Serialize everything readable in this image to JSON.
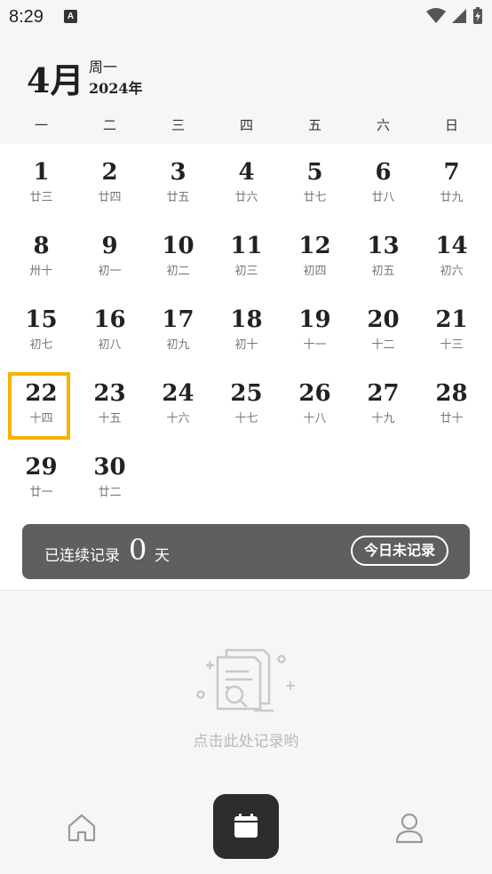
{
  "status_bar": {
    "time": "8:29",
    "notification_badge": "A"
  },
  "header": {
    "month": "4月",
    "weekday": "周一",
    "year": "2024年"
  },
  "weekday_headers": [
    "一",
    "二",
    "三",
    "四",
    "五",
    "六",
    "日"
  ],
  "days": [
    {
      "num": "1",
      "lunar": "廿三"
    },
    {
      "num": "2",
      "lunar": "廿四"
    },
    {
      "num": "3",
      "lunar": "廿五"
    },
    {
      "num": "4",
      "lunar": "廿六"
    },
    {
      "num": "5",
      "lunar": "廿七"
    },
    {
      "num": "6",
      "lunar": "廿八"
    },
    {
      "num": "7",
      "lunar": "廿九"
    },
    {
      "num": "8",
      "lunar": "卅十"
    },
    {
      "num": "9",
      "lunar": "初一"
    },
    {
      "num": "10",
      "lunar": "初二"
    },
    {
      "num": "11",
      "lunar": "初三"
    },
    {
      "num": "12",
      "lunar": "初四"
    },
    {
      "num": "13",
      "lunar": "初五"
    },
    {
      "num": "14",
      "lunar": "初六"
    },
    {
      "num": "15",
      "lunar": "初七"
    },
    {
      "num": "16",
      "lunar": "初八"
    },
    {
      "num": "17",
      "lunar": "初九"
    },
    {
      "num": "18",
      "lunar": "初十"
    },
    {
      "num": "19",
      "lunar": "十一"
    },
    {
      "num": "20",
      "lunar": "十二"
    },
    {
      "num": "21",
      "lunar": "十三"
    },
    {
      "num": "22",
      "lunar": "十四"
    },
    {
      "num": "23",
      "lunar": "十五"
    },
    {
      "num": "24",
      "lunar": "十六"
    },
    {
      "num": "25",
      "lunar": "十七"
    },
    {
      "num": "26",
      "lunar": "十八"
    },
    {
      "num": "27",
      "lunar": "十九"
    },
    {
      "num": "28",
      "lunar": "廿十"
    },
    {
      "num": "29",
      "lunar": "廿一"
    },
    {
      "num": "30",
      "lunar": "廿二"
    }
  ],
  "today": "22",
  "streak": {
    "label": "已连续记录",
    "count": "0",
    "unit": "天",
    "button": "今日未记录"
  },
  "empty_state": {
    "hint": "点击此处记录哟",
    "icon": "document-search-icon"
  },
  "nav": {
    "home_icon": "home-icon",
    "calendar_icon": "calendar-icon",
    "profile_icon": "profile-icon"
  },
  "colors": {
    "today_highlight": "#f4b400",
    "streak_bg": "#5f5f5f",
    "nav_active_bg": "#2d2d2d"
  }
}
